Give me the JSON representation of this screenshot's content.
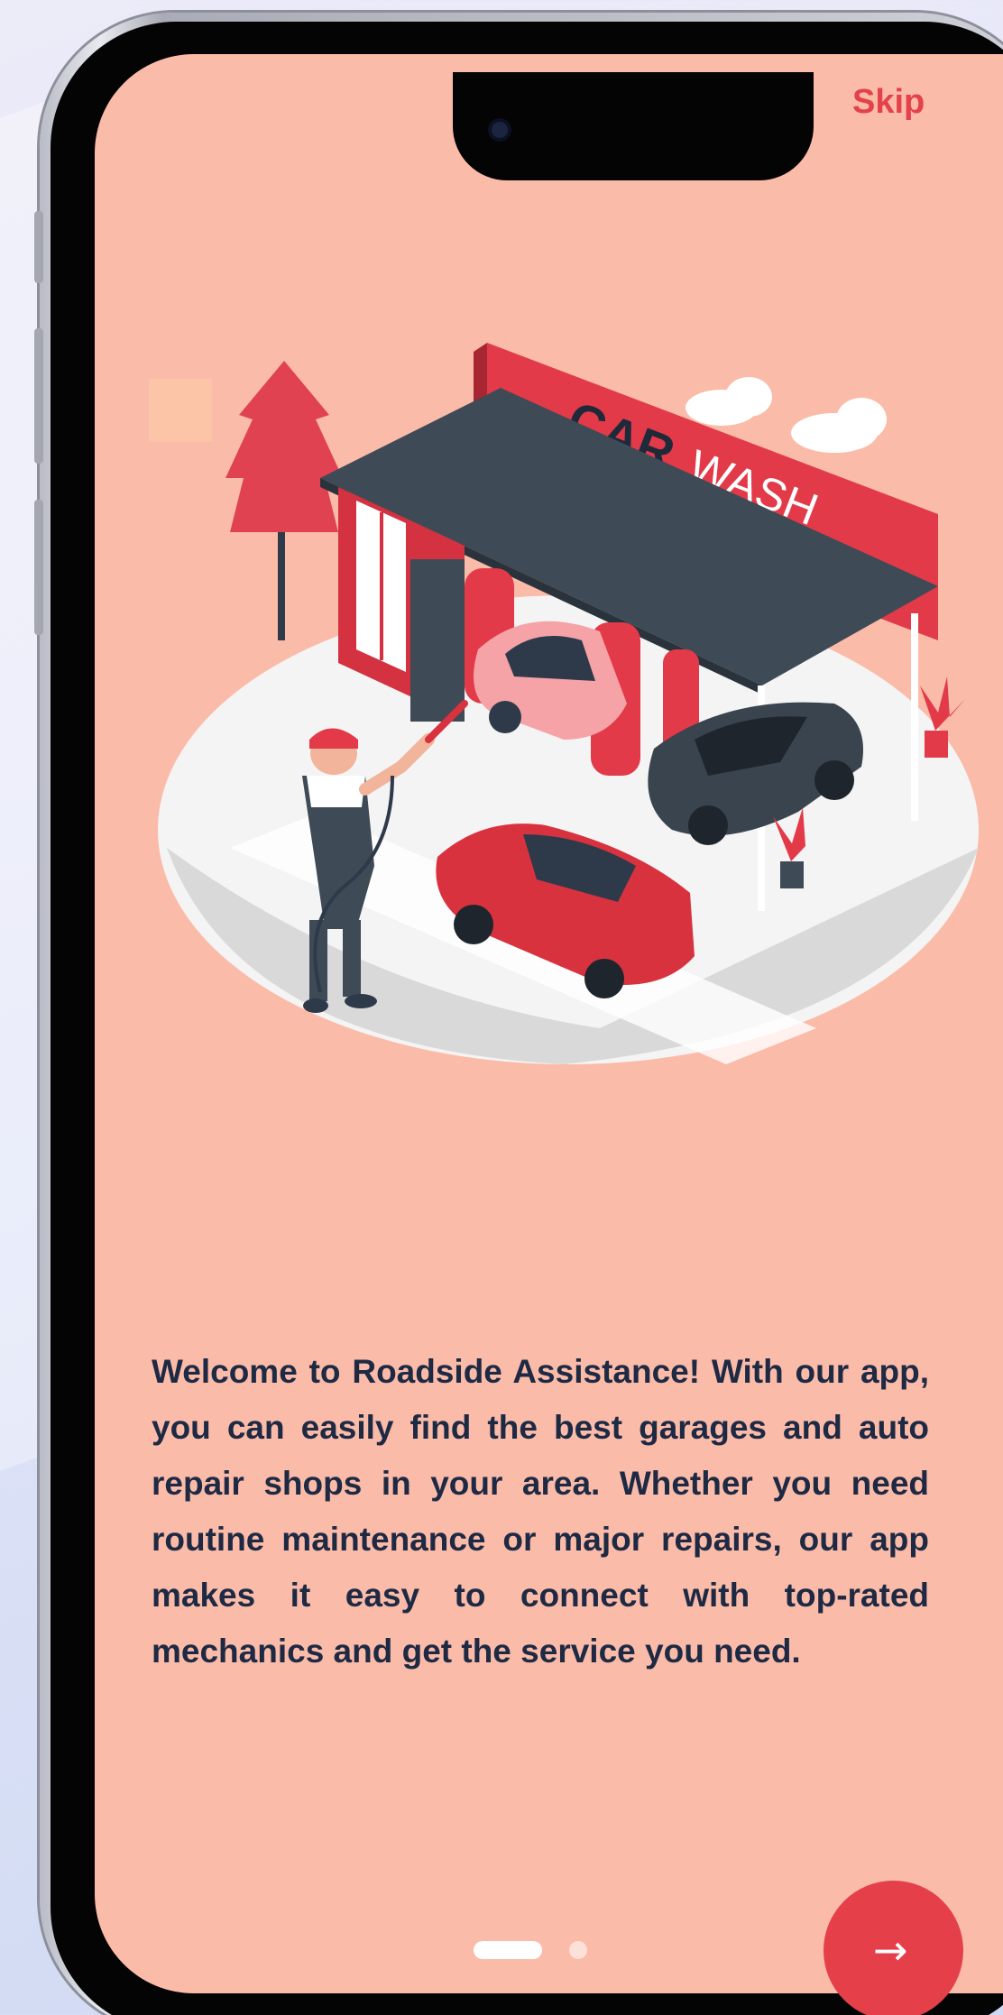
{
  "onboarding": {
    "skip_label": "Skip",
    "description": "Welcome to Roadside Assistance! With our app, you can easily find the best garages and auto repair shops in your area. Whether you need routine maintenance or major repairs, our app makes it easy to connect with top-rated mechanics and get the service you need.",
    "illustration": {
      "sign_word_1": "CAR",
      "sign_word_2": "WASH"
    },
    "pagination": {
      "current_page": 1,
      "total_pages": 2
    },
    "next_icon": "arrow-right-icon"
  },
  "colors": {
    "screen_background": "#fbbba9",
    "accent": "#e5404a",
    "text": "#1e2a44",
    "skip_text": "#e4414b"
  }
}
